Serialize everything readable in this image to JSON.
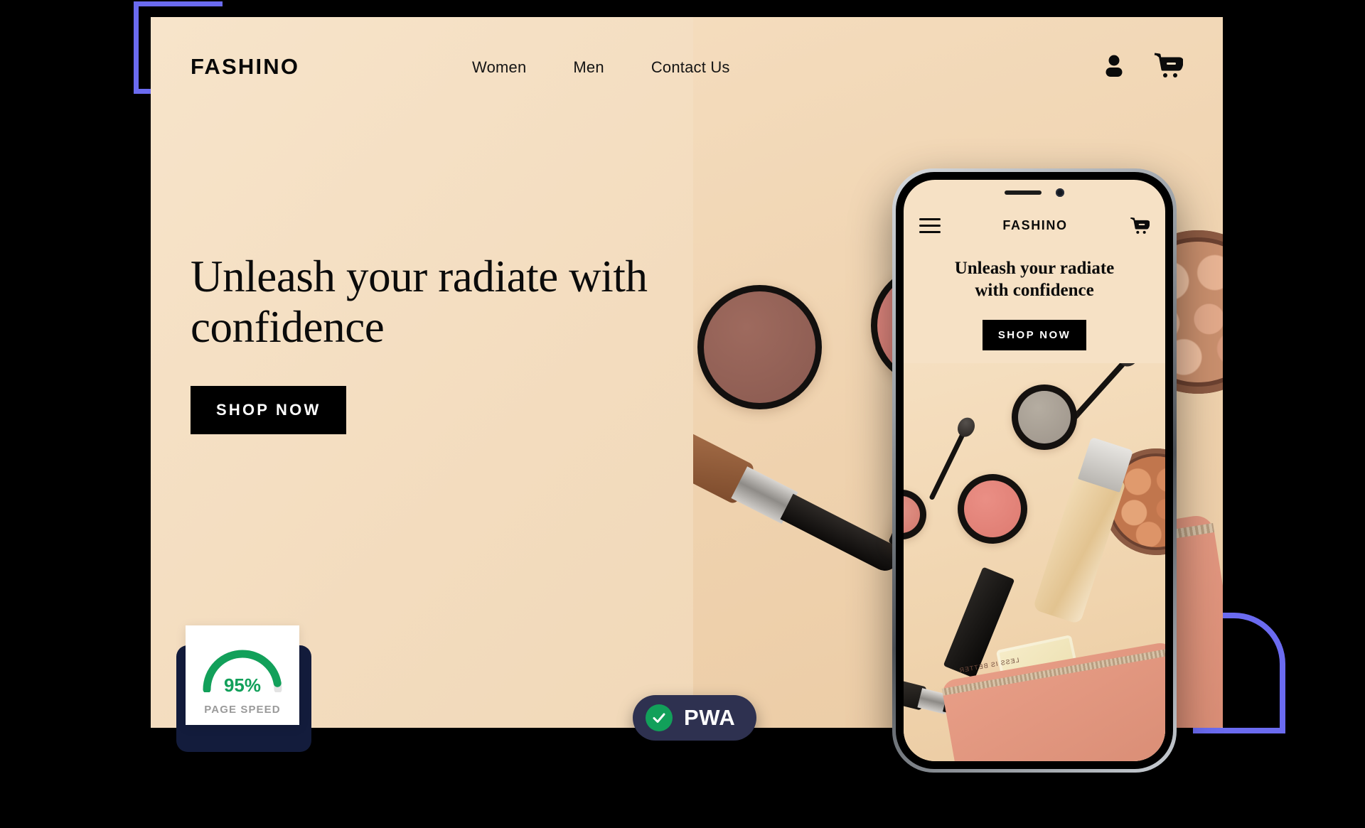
{
  "colors": {
    "hero_bg": "#F6E1C5",
    "accent_purple": "#6B6BF0",
    "dark": "#000000",
    "navy": "#2E3150",
    "shadow_navy": "#131C3C",
    "green": "#12A05A"
  },
  "site": {
    "brand": "FASHINO",
    "nav": [
      {
        "label": "Women"
      },
      {
        "label": "Men"
      },
      {
        "label": "Contact Us"
      }
    ],
    "icons": {
      "account": "user-icon",
      "cart": "shopping-cart-icon"
    },
    "hero": {
      "headline": "Unleash your radiate with confidence",
      "cta": "SHOP NOW"
    }
  },
  "page_speed": {
    "value": "95%",
    "label": "PAGE SPEED",
    "score": 95
  },
  "pwa_badge": {
    "label": "PWA",
    "check_icon": "check-circle-icon"
  },
  "phone": {
    "brand": "FASHINO",
    "menu_icon": "hamburger-menu-icon",
    "cart_icon": "shopping-cart-icon",
    "headline_line1": "Unleash your radiate",
    "headline_line2": "with confidence",
    "cta": "SHOP NOW",
    "pouch_text": "LESS IS BETTER"
  }
}
